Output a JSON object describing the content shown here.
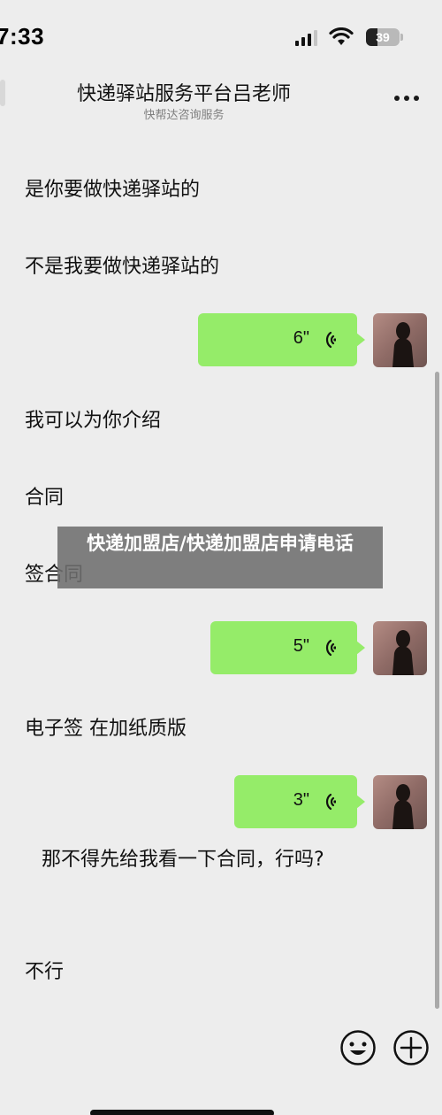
{
  "status_bar": {
    "time": "7:33",
    "battery": "39",
    "icons": [
      "signal-icon",
      "wifi-icon",
      "battery-icon"
    ]
  },
  "header": {
    "title": "快递驿站服务平台吕老师",
    "subtitle": "快帮达咨询服务",
    "more_icon": "more-icon"
  },
  "messages": [
    {
      "side": "left",
      "type": "text",
      "text": "是你要做快递驿站的"
    },
    {
      "side": "left",
      "type": "text",
      "text": "不是我要做快递驿站的"
    },
    {
      "side": "right",
      "type": "voice",
      "duration": "6\""
    },
    {
      "side": "left",
      "type": "text",
      "text": "我可以为你介绍"
    },
    {
      "side": "left",
      "type": "text",
      "text": "合同"
    },
    {
      "side": "left",
      "type": "text",
      "text": "签合同"
    },
    {
      "side": "right",
      "type": "voice",
      "duration": "5\""
    },
    {
      "side": "left",
      "type": "text",
      "text": "电子签 在加纸质版"
    },
    {
      "side": "right",
      "type": "voice",
      "duration": "3\""
    },
    {
      "side": "left",
      "type": "text",
      "text": "那不得先给我看一下合同，行吗?"
    },
    {
      "side": "left",
      "type": "text",
      "text": "不行"
    }
  ],
  "overlay": {
    "text": "快递加盟店/快递加盟店申请电话"
  },
  "bottom_bar": {
    "icons": [
      "emoji-icon",
      "plus-icon"
    ]
  },
  "colors": {
    "background": "#ededed",
    "voice_bubble": "#95ec69",
    "overlay": "#6e6e6e"
  }
}
